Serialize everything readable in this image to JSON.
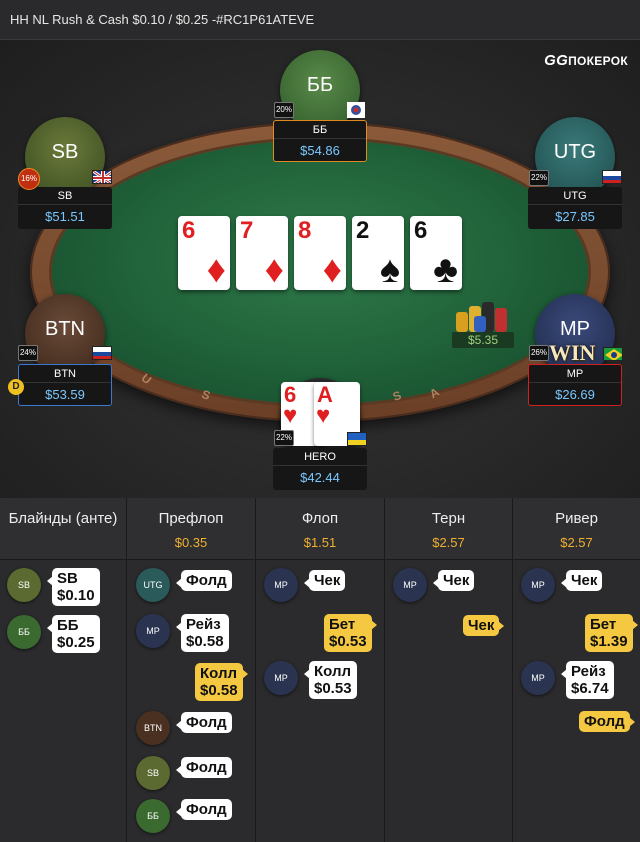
{
  "title": "HH NL Rush & Cash $0.10 / $0.25 -#RC1P61ATEVE",
  "logo": {
    "gg": "GG",
    "text": "ПОКЕРОК"
  },
  "rail_letters": [
    "U",
    "S",
    "S",
    "A"
  ],
  "board": [
    {
      "rank": "6",
      "suit": "♦",
      "color": "#e02020"
    },
    {
      "rank": "7",
      "suit": "♦",
      "color": "#e02020"
    },
    {
      "rank": "8",
      "suit": "♦",
      "color": "#e02020"
    },
    {
      "rank": "2",
      "suit": "♠",
      "color": "#111111"
    },
    {
      "rank": "6",
      "suit": "♣",
      "color": "#111111"
    }
  ],
  "hero_cards": [
    {
      "rank": "6",
      "suit": "♥"
    },
    {
      "rank": "A",
      "suit": "♥"
    }
  ],
  "players": {
    "bb": {
      "avatar": "ББ",
      "name": "ББ",
      "stack": "$54.86",
      "pct": "20%"
    },
    "sb": {
      "avatar": "SB",
      "name": "SB",
      "stack": "$51.51",
      "pct": "16%"
    },
    "utg": {
      "avatar": "UTG",
      "name": "UTG",
      "stack": "$27.85",
      "pct": "22%"
    },
    "btn": {
      "avatar": "BTN",
      "name": "BTN",
      "stack": "$53.59",
      "pct": "24%",
      "dealer": "D"
    },
    "mp": {
      "avatar": "MP",
      "name": "MP",
      "stack": "$26.69",
      "pct": "26%",
      "badge": "WIN"
    },
    "hero": {
      "name": "HERO",
      "stack": "$42.44",
      "pct": "22%"
    }
  },
  "pot": "$5.35",
  "colors": {
    "accent_gold": "#f0b030",
    "stack_blue": "#7ac8ff",
    "felt": "#1f6038"
  },
  "history": {
    "blinds": {
      "header": "Блайнды (анте)",
      "rows": [
        {
          "avatar": "SB",
          "action": "SB",
          "amount": "$0.10"
        },
        {
          "avatar": "ББ",
          "action": "ББ",
          "amount": "$0.25"
        }
      ]
    },
    "preflop": {
      "header": "Префлоп",
      "pot": "$0.35",
      "rows": [
        {
          "avatar": "UTG",
          "action": "Фолд"
        },
        {
          "avatar": "MP",
          "action": "Рейз",
          "amount": "$0.58"
        },
        {
          "action": "Колл",
          "amount": "$0.58"
        },
        {
          "avatar": "BTN",
          "action": "Фолд"
        },
        {
          "avatar": "SB",
          "action": "Фолд"
        },
        {
          "avatar": "ББ",
          "action": "Фолд"
        }
      ]
    },
    "flop": {
      "header": "Флоп",
      "pot": "$1.51",
      "rows": [
        {
          "avatar": "MP",
          "action": "Чек"
        },
        {
          "action": "Бет",
          "amount": "$0.53"
        },
        {
          "avatar": "MP",
          "action": "Колл",
          "amount": "$0.53"
        }
      ]
    },
    "turn": {
      "header": "Терн",
      "pot": "$2.57",
      "rows": [
        {
          "avatar": "MP",
          "action": "Чек"
        },
        {
          "action": "Чек"
        }
      ]
    },
    "river": {
      "header": "Ривер",
      "pot": "$2.57",
      "rows": [
        {
          "avatar": "MP",
          "action": "Чек"
        },
        {
          "action": "Бет",
          "amount": "$1.39"
        },
        {
          "avatar": "MP",
          "action": "Рейз",
          "amount": "$6.74"
        },
        {
          "action": "Фолд"
        }
      ]
    }
  }
}
